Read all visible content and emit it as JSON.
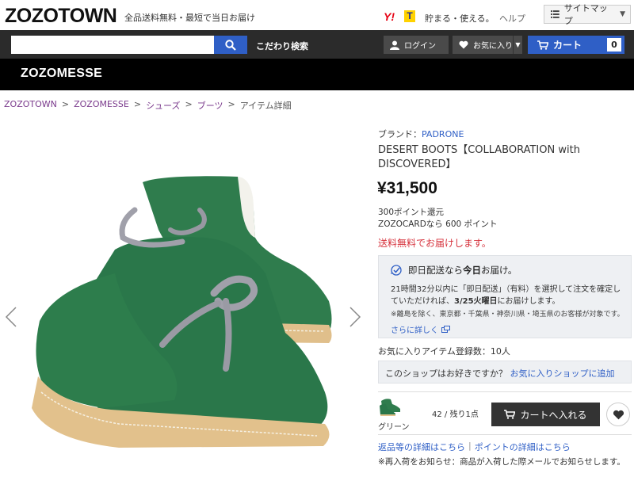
{
  "header": {
    "logo": "ZOZOTOWN",
    "tagline": "全品送料無料・最短で当日お届け",
    "yahoo_badge": "Y!",
    "tpoint_badge": "T",
    "tamaru": "貯まる・使える。",
    "help": "ヘルプ",
    "sitemap": "サイトマップ"
  },
  "nav": {
    "search_placeholder": "",
    "kodawari": "こだわり検索",
    "login": "ログイン",
    "favorites": "お気に入り",
    "cart": "カート",
    "cart_count": "0"
  },
  "subheader": {
    "title": "ZOZOMESSE"
  },
  "breadcrumb": {
    "items": [
      "ZOZOTOWN",
      "ZOZOMESSE",
      "シューズ",
      "ブーツ",
      "アイテム詳細"
    ],
    "separator": ">"
  },
  "product": {
    "brand_label": "ブランド：",
    "brand": "PADRONE",
    "title": "DESERT BOOTS【COLLABORATION with DISCOVERED】",
    "price": "¥31,500",
    "points_line1": "300ポイント還元",
    "points_line2": "ZOZOCARDなら 600 ポイント",
    "free_shipping": "送料無料でお届けします。",
    "colors": {
      "boot": "#2e7a4c",
      "sole": "#e3c28f",
      "lace": "#9a9aa3"
    }
  },
  "delivery": {
    "head_prefix": "即日配送なら",
    "head_bold": "今日",
    "head_suffix": "お届け。",
    "body_prefix": "21時間32分以内に「即日配送」（有料）を選択して注文を確定していただければ、",
    "body_bold": "3/25火曜日",
    "body_suffix": "にお届けします。",
    "note": "※離島を除く、東京都・千葉県・神奈川県・埼玉県のお客様が対象です。",
    "more": "さらに詳しく"
  },
  "favorites": {
    "count_text": "お気に入りアイテム登録数：10人",
    "shop_question": "このショップはお好きですか？",
    "shop_link": "お気に入りショップに追加"
  },
  "sku": {
    "color": "グリーン",
    "stock": "42 / 残り1点",
    "add_to_cart": "カートへ入れる"
  },
  "footer_links": {
    "returns": "返品等の詳細はこちら",
    "separator": "|",
    "points": "ポイントの詳細はこちら",
    "restock": "※再入荷をお知らせ：商品が入荷した際メールでお知らせします。"
  }
}
